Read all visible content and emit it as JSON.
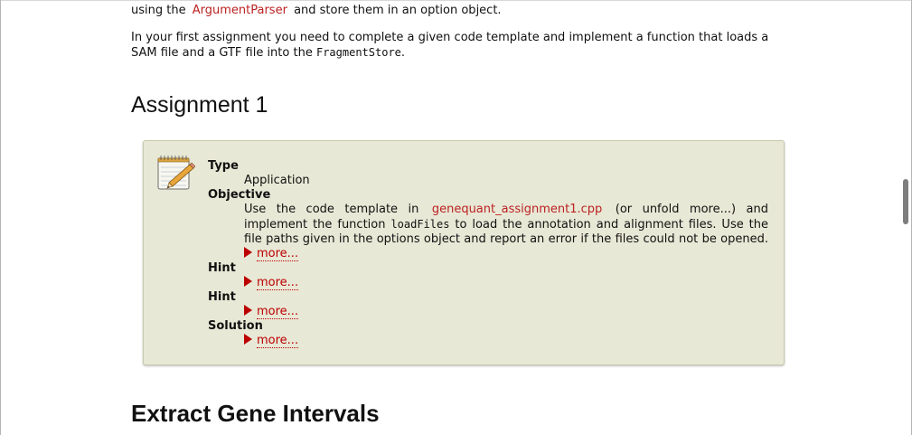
{
  "intro": {
    "p1_prefix": "using the",
    "p1_link": "ArgumentParser",
    "p1_suffix": "and store them in an option object.",
    "p2_text": "In your first assignment you need to complete a given code template and implement a function that loads a SAM file and a GTF file into the",
    "p2_code": "FragmentStore",
    "p2_end": "."
  },
  "assignment": {
    "heading": "Assignment 1",
    "type_label": "Type",
    "type_value": "Application",
    "objective_label": "Objective",
    "objective_1": "Use the code template in",
    "objective_link": "genequant_assignment1.cpp",
    "objective_2": "(or unfold more...) and implement the function",
    "objective_code": "loadFiles",
    "objective_3": "to load the annotation and alignment files. Use the file paths given in the options object and report an error if the files could not be opened.",
    "objective_more": "more...",
    "hint1_label": "Hint",
    "hint1_more": "more...",
    "hint2_label": "Hint",
    "hint2_more": "more...",
    "solution_label": "Solution",
    "solution_more": "more..."
  },
  "next_section": {
    "heading": "Extract Gene Intervals"
  },
  "icons": {
    "assignment_icon": "notepad-pencil-icon",
    "expand_icon": "triangle-right-icon"
  },
  "colors": {
    "link": "#bb2222",
    "box_background": "#e8e8d6",
    "box_border": "#c9c9ad"
  }
}
